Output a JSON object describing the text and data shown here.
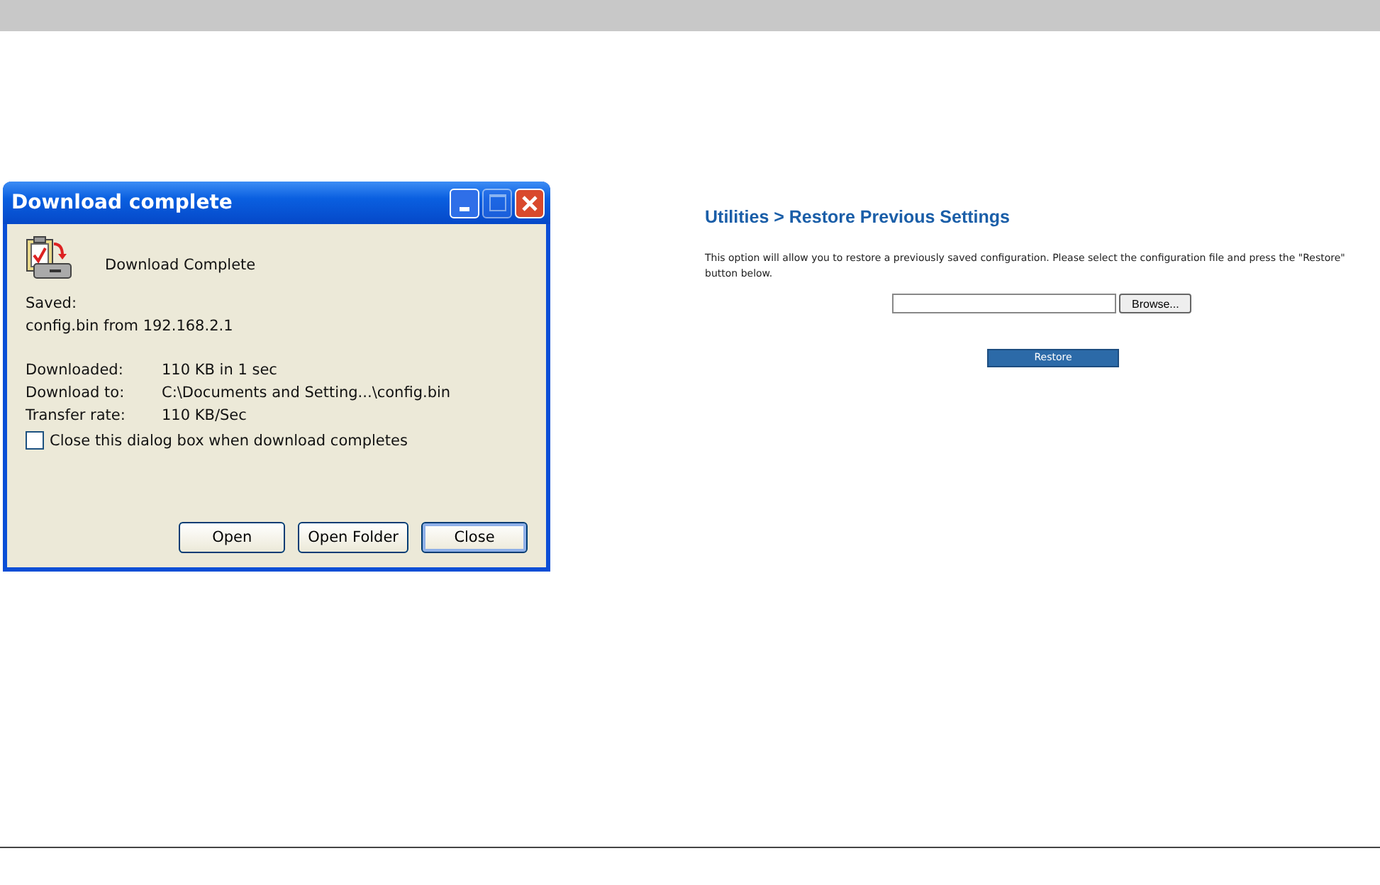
{
  "dialog": {
    "title": "Download complete",
    "heading": "Download Complete",
    "saved_label": "Saved:",
    "saved_file": "config.bin from 192.168.2.1",
    "details": [
      {
        "label": "Downloaded:",
        "value": "110 KB in 1 sec"
      },
      {
        "label": "Download to:",
        "value": "C:\\Documents and Setting...\\config.bin"
      },
      {
        "label": "Transfer rate:",
        "value": "110 KB/Sec"
      }
    ],
    "close_when_done": {
      "label": "Close this dialog box when download completes",
      "checked": false
    },
    "buttons": [
      {
        "label": "Open",
        "default": false
      },
      {
        "label": "Open Folder",
        "default": false
      },
      {
        "label": "Close",
        "default": true
      }
    ]
  },
  "restore_page": {
    "title": "Utilities > Restore Previous Settings",
    "description": "This option will allow you to restore a previously saved configuration. Please select the configuration file and press the \"Restore\" button below.",
    "browse_button": "Browse...",
    "restore_button": "Restore"
  }
}
